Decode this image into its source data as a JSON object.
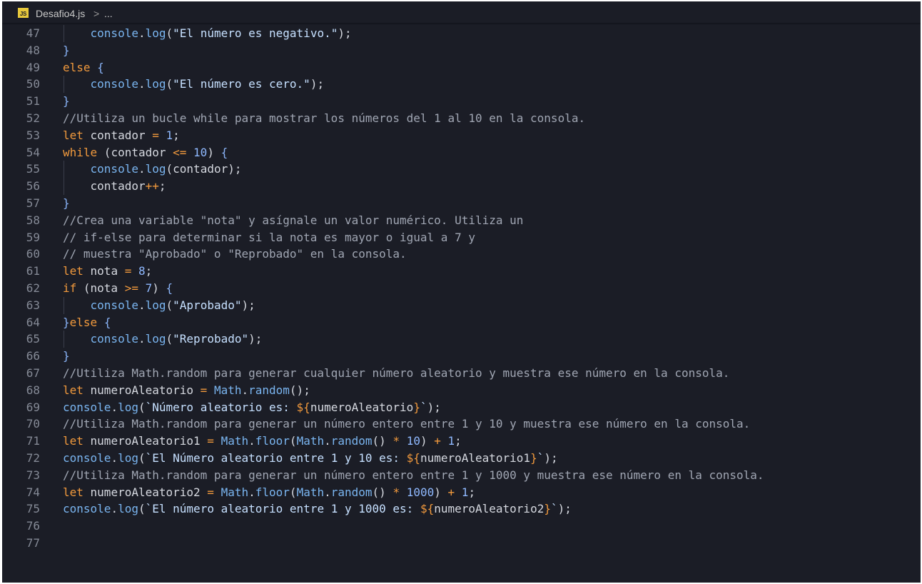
{
  "breadcrumb": {
    "file_icon": "JS",
    "file_name": "Desafio4.js",
    "separator": ">",
    "more": "..."
  },
  "colors": {
    "background": "#1b1d26",
    "keyword": "#f29a3d",
    "function": "#7ab5f0",
    "number": "#8fb9ff",
    "comment": "#a0a6b3"
  },
  "code_lines": [
    {
      "n": "47",
      "guide": true,
      "tokens": [
        [
          "pad",
          "    "
        ],
        [
          "fn",
          "console"
        ],
        [
          "pun",
          "."
        ],
        [
          "fn",
          "log"
        ],
        [
          "pun",
          "("
        ],
        [
          "str",
          "\"El número es negativo.\""
        ],
        [
          "pun",
          ");"
        ]
      ]
    },
    {
      "n": "48",
      "guide": false,
      "tokens": [
        [
          "brc",
          "}"
        ]
      ]
    },
    {
      "n": "49",
      "guide": false,
      "tokens": [
        [
          "kw",
          "else"
        ],
        [
          "pun",
          " "
        ],
        [
          "brc",
          "{"
        ]
      ]
    },
    {
      "n": "50",
      "guide": true,
      "tokens": [
        [
          "pad",
          "    "
        ],
        [
          "fn",
          "console"
        ],
        [
          "pun",
          "."
        ],
        [
          "fn",
          "log"
        ],
        [
          "pun",
          "("
        ],
        [
          "str",
          "\"El número es cero.\""
        ],
        [
          "pun",
          ");"
        ]
      ]
    },
    {
      "n": "51",
      "guide": false,
      "tokens": [
        [
          "brc",
          "}"
        ]
      ]
    },
    {
      "n": "52",
      "guide": false,
      "tokens": [
        [
          "cm",
          "//Utiliza un bucle while para mostrar los números del 1 al 10 en la consola."
        ]
      ]
    },
    {
      "n": "53",
      "guide": false,
      "tokens": [
        [
          "kw",
          "let"
        ],
        [
          "var",
          " contador "
        ],
        [
          "op",
          "="
        ],
        [
          "pun",
          " "
        ],
        [
          "num",
          "1"
        ],
        [
          "pun",
          ";"
        ]
      ]
    },
    {
      "n": "54",
      "guide": false,
      "tokens": [
        [
          "kw",
          "while"
        ],
        [
          "pun",
          " ("
        ],
        [
          "var",
          "contador "
        ],
        [
          "op",
          "<="
        ],
        [
          "pun",
          " "
        ],
        [
          "num",
          "10"
        ],
        [
          "pun",
          ") "
        ],
        [
          "brc",
          "{"
        ]
      ]
    },
    {
      "n": "55",
      "guide": true,
      "tokens": [
        [
          "pad",
          "    "
        ],
        [
          "fn",
          "console"
        ],
        [
          "pun",
          "."
        ],
        [
          "fn",
          "log"
        ],
        [
          "pun",
          "("
        ],
        [
          "var",
          "contador"
        ],
        [
          "pun",
          ");"
        ]
      ]
    },
    {
      "n": "56",
      "guide": true,
      "tokens": [
        [
          "pad",
          "    "
        ],
        [
          "var",
          "contador"
        ],
        [
          "op",
          "++"
        ],
        [
          "pun",
          ";"
        ]
      ]
    },
    {
      "n": "57",
      "guide": false,
      "tokens": [
        [
          "brc",
          "}"
        ]
      ]
    },
    {
      "n": "58",
      "guide": false,
      "tokens": [
        [
          "cm",
          "//Crea una variable \"nota\" y asígnale un valor numérico. Utiliza un"
        ]
      ]
    },
    {
      "n": "59",
      "guide": false,
      "tokens": [
        [
          "cm",
          "// if-else para determinar si la nota es mayor o igual a 7 y"
        ]
      ]
    },
    {
      "n": "60",
      "guide": false,
      "tokens": [
        [
          "cm",
          "// muestra \"Aprobado\" o \"Reprobado\" en la consola."
        ]
      ]
    },
    {
      "n": "61",
      "guide": false,
      "tokens": [
        [
          "kw",
          "let"
        ],
        [
          "var",
          " nota "
        ],
        [
          "op",
          "="
        ],
        [
          "pun",
          " "
        ],
        [
          "num",
          "8"
        ],
        [
          "pun",
          ";"
        ]
      ]
    },
    {
      "n": "62",
      "guide": false,
      "tokens": [
        [
          "kw",
          "if"
        ],
        [
          "pun",
          " ("
        ],
        [
          "var",
          "nota "
        ],
        [
          "op",
          ">="
        ],
        [
          "pun",
          " "
        ],
        [
          "num",
          "7"
        ],
        [
          "pun",
          ") "
        ],
        [
          "brc",
          "{"
        ]
      ]
    },
    {
      "n": "63",
      "guide": true,
      "tokens": [
        [
          "pad",
          "    "
        ],
        [
          "fn",
          "console"
        ],
        [
          "pun",
          "."
        ],
        [
          "fn",
          "log"
        ],
        [
          "pun",
          "("
        ],
        [
          "str",
          "\"Aprobado\""
        ],
        [
          "pun",
          ");"
        ]
      ]
    },
    {
      "n": "64",
      "guide": false,
      "tokens": [
        [
          "brc",
          "}"
        ],
        [
          "kw",
          "else"
        ],
        [
          "pun",
          " "
        ],
        [
          "brc",
          "{"
        ]
      ]
    },
    {
      "n": "65",
      "guide": true,
      "tokens": [
        [
          "pad",
          "    "
        ],
        [
          "fn",
          "console"
        ],
        [
          "pun",
          "."
        ],
        [
          "fn",
          "log"
        ],
        [
          "pun",
          "("
        ],
        [
          "str",
          "\"Reprobado\""
        ],
        [
          "pun",
          ");"
        ]
      ]
    },
    {
      "n": "66",
      "guide": false,
      "tokens": [
        [
          "brc",
          "}"
        ]
      ]
    },
    {
      "n": "67",
      "guide": false,
      "tokens": [
        [
          "cm",
          "//Utiliza Math.random para generar cualquier número aleatorio y muestra ese número en la consola."
        ]
      ]
    },
    {
      "n": "68",
      "guide": false,
      "tokens": [
        [
          "kw",
          "let"
        ],
        [
          "var",
          " numeroAleatorio "
        ],
        [
          "op",
          "="
        ],
        [
          "pun",
          " "
        ],
        [
          "fn",
          "Math"
        ],
        [
          "pun",
          "."
        ],
        [
          "fn",
          "random"
        ],
        [
          "pun",
          "();"
        ]
      ]
    },
    {
      "n": "69",
      "guide": false,
      "tokens": [
        [
          "fn",
          "console"
        ],
        [
          "pun",
          "."
        ],
        [
          "fn",
          "log"
        ],
        [
          "pun",
          "("
        ],
        [
          "str",
          "`Número aleatorio es: "
        ],
        [
          "op",
          "${"
        ],
        [
          "var",
          "numeroAleatorio"
        ],
        [
          "op",
          "}"
        ],
        [
          "str",
          "`"
        ],
        [
          "pun",
          ");"
        ]
      ]
    },
    {
      "n": "70",
      "guide": false,
      "tokens": [
        [
          "cm",
          "//Utiliza Math.random para generar un número entero entre 1 y 10 y muestra ese número en la consola."
        ]
      ]
    },
    {
      "n": "71",
      "guide": false,
      "tokens": [
        [
          "kw",
          "let"
        ],
        [
          "var",
          " numeroAleatorio1 "
        ],
        [
          "op",
          "="
        ],
        [
          "pun",
          " "
        ],
        [
          "fn",
          "Math"
        ],
        [
          "pun",
          "."
        ],
        [
          "fn",
          "floor"
        ],
        [
          "pun",
          "("
        ],
        [
          "fn",
          "Math"
        ],
        [
          "pun",
          "."
        ],
        [
          "fn",
          "random"
        ],
        [
          "pun",
          "() "
        ],
        [
          "op",
          "*"
        ],
        [
          "pun",
          " "
        ],
        [
          "num",
          "10"
        ],
        [
          "pun",
          ") "
        ],
        [
          "op",
          "+"
        ],
        [
          "pun",
          " "
        ],
        [
          "num",
          "1"
        ],
        [
          "pun",
          ";"
        ]
      ]
    },
    {
      "n": "72",
      "guide": false,
      "tokens": [
        [
          "fn",
          "console"
        ],
        [
          "pun",
          "."
        ],
        [
          "fn",
          "log"
        ],
        [
          "pun",
          "("
        ],
        [
          "str",
          "`El Número aleatorio entre 1 y 10 es: "
        ],
        [
          "op",
          "${"
        ],
        [
          "var",
          "numeroAleatorio1"
        ],
        [
          "op",
          "}"
        ],
        [
          "str",
          "`"
        ],
        [
          "pun",
          ");"
        ]
      ]
    },
    {
      "n": "73",
      "guide": false,
      "tokens": [
        [
          "cm",
          "//Utiliza Math.random para generar un número entero entre 1 y 1000 y muestra ese número en la consola."
        ]
      ]
    },
    {
      "n": "74",
      "guide": false,
      "tokens": [
        [
          "kw",
          "let"
        ],
        [
          "var",
          " numeroAleatorio2 "
        ],
        [
          "op",
          "="
        ],
        [
          "pun",
          " "
        ],
        [
          "fn",
          "Math"
        ],
        [
          "pun",
          "."
        ],
        [
          "fn",
          "floor"
        ],
        [
          "pun",
          "("
        ],
        [
          "fn",
          "Math"
        ],
        [
          "pun",
          "."
        ],
        [
          "fn",
          "random"
        ],
        [
          "pun",
          "() "
        ],
        [
          "op",
          "*"
        ],
        [
          "pun",
          " "
        ],
        [
          "num",
          "1000"
        ],
        [
          "pun",
          ") "
        ],
        [
          "op",
          "+"
        ],
        [
          "pun",
          " "
        ],
        [
          "num",
          "1"
        ],
        [
          "pun",
          ";"
        ]
      ]
    },
    {
      "n": "75",
      "guide": false,
      "tokens": [
        [
          "fn",
          "console"
        ],
        [
          "pun",
          "."
        ],
        [
          "fn",
          "log"
        ],
        [
          "pun",
          "("
        ],
        [
          "str",
          "`El número aleatorio entre 1 y 1000 es: "
        ],
        [
          "op",
          "${"
        ],
        [
          "var",
          "numeroAleatorio2"
        ],
        [
          "op",
          "}"
        ],
        [
          "str",
          "`"
        ],
        [
          "pun",
          ");"
        ]
      ]
    },
    {
      "n": "76",
      "guide": false,
      "tokens": []
    },
    {
      "n": "77",
      "guide": false,
      "tokens": []
    }
  ]
}
